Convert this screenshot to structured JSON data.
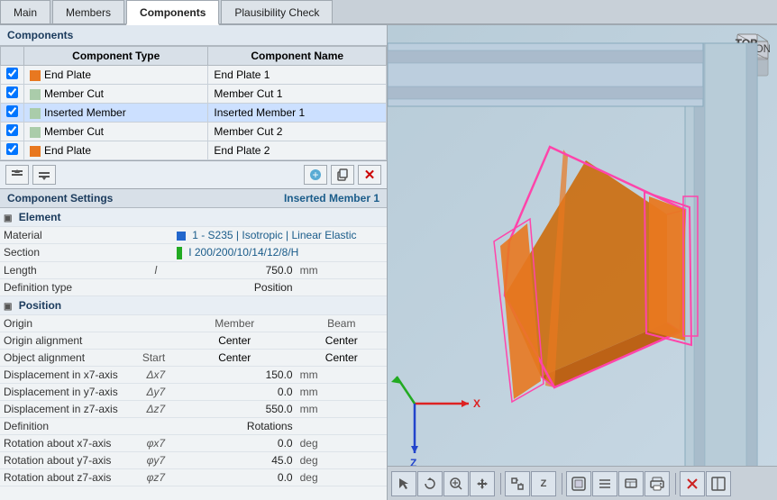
{
  "tabs": [
    {
      "id": "main",
      "label": "Main"
    },
    {
      "id": "members",
      "label": "Members"
    },
    {
      "id": "components",
      "label": "Components"
    },
    {
      "id": "plausibility",
      "label": "Plausibility Check"
    }
  ],
  "activeTab": "components",
  "componentsSection": {
    "title": "Components",
    "tableHeaders": [
      "Component Type",
      "Component Name"
    ],
    "rows": [
      {
        "id": 1,
        "checked": true,
        "color": "#e87820",
        "type": "End Plate",
        "name": "End Plate 1",
        "selected": false
      },
      {
        "id": 2,
        "checked": true,
        "color": "#aaccaa",
        "type": "Member Cut",
        "name": "Member Cut 1",
        "selected": false
      },
      {
        "id": 3,
        "checked": true,
        "color": "#aaccaa",
        "type": "Inserted Member",
        "name": "Inserted Member 1",
        "selected": true
      },
      {
        "id": 4,
        "checked": true,
        "color": "#aaccaa",
        "type": "Member Cut",
        "name": "Member Cut 2",
        "selected": false
      },
      {
        "id": 5,
        "checked": true,
        "color": "#e87820",
        "type": "End Plate",
        "name": "End Plate 2",
        "selected": false
      }
    ]
  },
  "toolbar": {
    "buttons": [
      "⊞",
      "⊟",
      "⚙",
      "💾",
      "✕"
    ]
  },
  "settingsSection": {
    "title": "Component Settings",
    "context": "Inserted Member 1",
    "groups": [
      {
        "id": "element",
        "label": "Element",
        "properties": [
          {
            "label": "Material",
            "symbol": "",
            "value": "1 - S235 | Isotropic | Linear Elastic",
            "unit": "",
            "type": "material"
          },
          {
            "label": "Section",
            "symbol": "",
            "value": "I 200/200/10/14/12/8/H",
            "unit": "",
            "type": "section"
          },
          {
            "label": "Length",
            "symbol": "l",
            "value": "750.0",
            "unit": "mm"
          },
          {
            "label": "Definition type",
            "symbol": "",
            "value": "Position",
            "unit": ""
          }
        ]
      },
      {
        "id": "position",
        "label": "Position",
        "headers": [
          "Member",
          "Beam"
        ],
        "properties": [
          {
            "label": "Origin",
            "symbol": "",
            "col1": "Member",
            "col2": "Beam",
            "type": "header-row"
          },
          {
            "label": "Origin alignment",
            "symbol": "",
            "col1": "Center",
            "col2": "Center"
          },
          {
            "label": "Object alignment",
            "symbol": "",
            "col1": "Center",
            "col2": "Center",
            "sub1": "Start"
          },
          {
            "label": "Displacement in x7-axis",
            "symbol": "Δx7",
            "value": "150.0",
            "unit": "mm"
          },
          {
            "label": "Displacement in y7-axis",
            "symbol": "Δy7",
            "value": "0.0",
            "unit": "mm"
          },
          {
            "label": "Displacement in z7-axis",
            "symbol": "Δz7",
            "value": "550.0",
            "unit": "mm"
          },
          {
            "label": "Definition",
            "symbol": "",
            "value": "Rotations",
            "unit": ""
          },
          {
            "label": "Rotation about x7-axis",
            "symbol": "φx7",
            "value": "0.0",
            "unit": "deg"
          },
          {
            "label": "Rotation about y7-axis",
            "symbol": "φy7",
            "value": "45.0",
            "unit": "deg"
          },
          {
            "label": "Rotation about z7-axis",
            "symbol": "φz7",
            "value": "0.0",
            "unit": "deg"
          }
        ]
      }
    ]
  },
  "viewToolbar": {
    "buttons": [
      {
        "icon": "⊞",
        "name": "select-tool"
      },
      {
        "icon": "↺",
        "name": "rotate-tool"
      },
      {
        "icon": "⊕",
        "name": "zoom-tool"
      },
      {
        "icon": "↔",
        "name": "pan-tool"
      },
      {
        "icon": "↕",
        "name": "fit-tool"
      },
      {
        "icon": "Z",
        "name": "z-axis"
      },
      {
        "icon": "⊡",
        "name": "view-mode"
      },
      {
        "icon": "≡",
        "name": "display-options"
      },
      {
        "icon": "⊞",
        "name": "grid"
      },
      {
        "icon": "🖨",
        "name": "print"
      },
      {
        "icon": "✕",
        "name": "close-view"
      },
      {
        "icon": "⊟",
        "name": "panel"
      }
    ]
  }
}
